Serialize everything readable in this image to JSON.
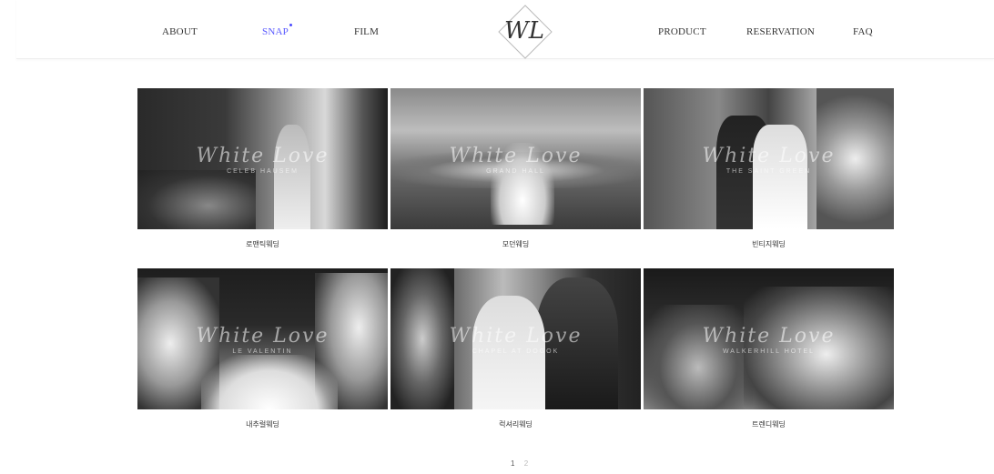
{
  "nav": {
    "left": [
      "ABOUT",
      "SNAP",
      "FILM"
    ],
    "right": [
      "PRODUCT",
      "RESERVATION",
      "FAQ"
    ],
    "active": "SNAP",
    "logo_text": "WL"
  },
  "gallery": [
    {
      "caption": "로맨틱웨딩",
      "watermark": "White Love",
      "sub": "CELEB HAUSEM"
    },
    {
      "caption": "모던웨딩",
      "watermark": "White Love",
      "sub": "GRAND HALL"
    },
    {
      "caption": "빈티지웨딩",
      "watermark": "White Love",
      "sub": "THE SAINT GREEN"
    },
    {
      "caption": "내추럴웨딩",
      "watermark": "White Love",
      "sub": "LE VALENTIN"
    },
    {
      "caption": "럭셔리웨딩",
      "watermark": "White Love",
      "sub": "CHAPEL AT DOGOK"
    },
    {
      "caption": "트렌디웨딩",
      "watermark": "White Love",
      "sub": "WALKERHILL HOTEL"
    }
  ],
  "pagination": [
    "1",
    "2"
  ],
  "colors": {
    "accent": "#5b5bff",
    "text": "#333333"
  }
}
